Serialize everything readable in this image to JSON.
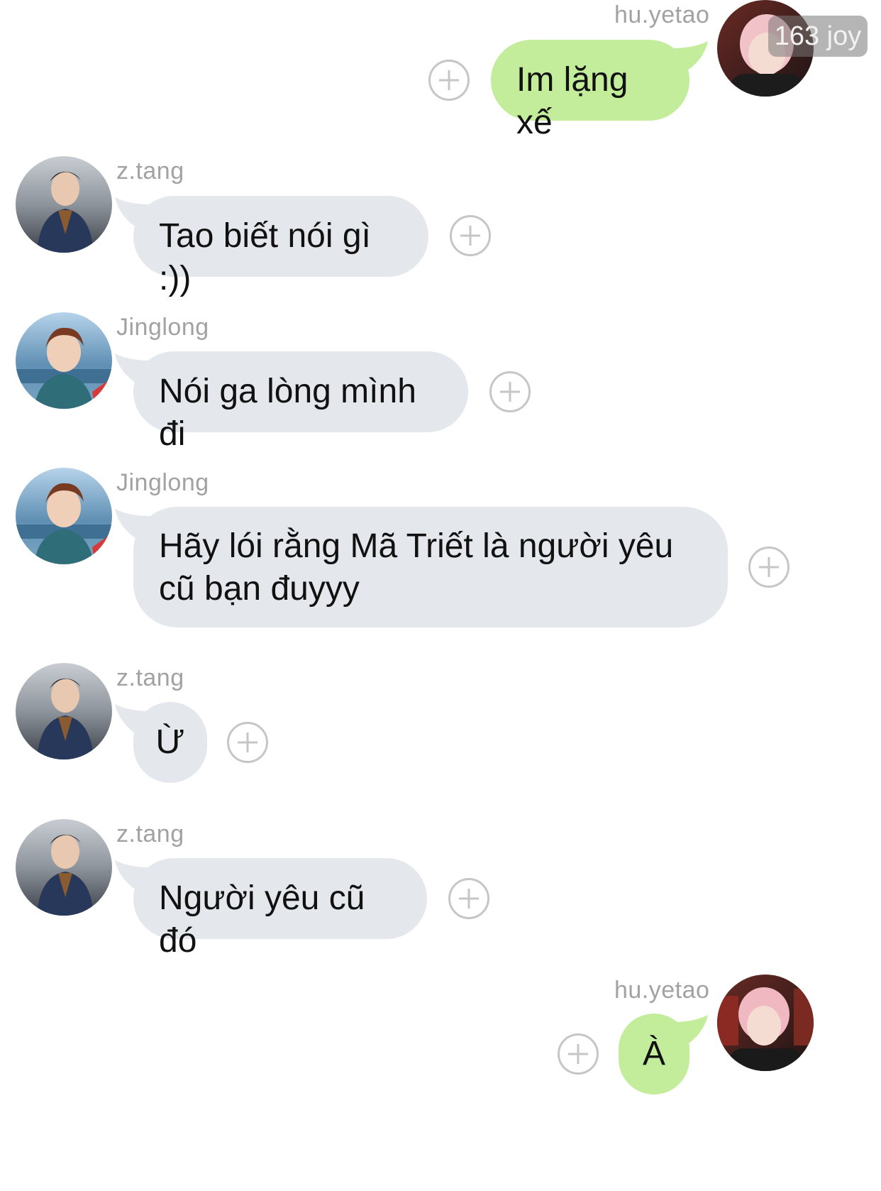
{
  "chat": {
    "messages": [
      {
        "sender": "hu.yetao",
        "text": "Im lặng xế",
        "side": "out"
      },
      {
        "sender": "z.tang",
        "text": "Tao biết nói gì :))",
        "side": "in"
      },
      {
        "sender": "Jinglong",
        "text": "Nói ga lòng mình đi",
        "side": "in"
      },
      {
        "sender": "Jinglong",
        "text": "Hãy lói rằng Mã Triết là người yêu cũ bạn đuyyy",
        "side": "in"
      },
      {
        "sender": "z.tang",
        "text": "Ừ",
        "side": "in"
      },
      {
        "sender": "z.tang",
        "text": "Người yêu cũ đó",
        "side": "in"
      },
      {
        "sender": "hu.yetao",
        "text": "À",
        "side": "out"
      }
    ],
    "avatar_badge": "163 joy"
  },
  "colors": {
    "incoming_bubble": "#e4e7eb",
    "outgoing_bubble": "#c3ec9b",
    "sender_name": "#a2a2a2",
    "add_reaction_icon": "#c6c6c6"
  },
  "icons": {
    "add_reaction": "plus-circle-icon",
    "avatar": "user-photo"
  }
}
